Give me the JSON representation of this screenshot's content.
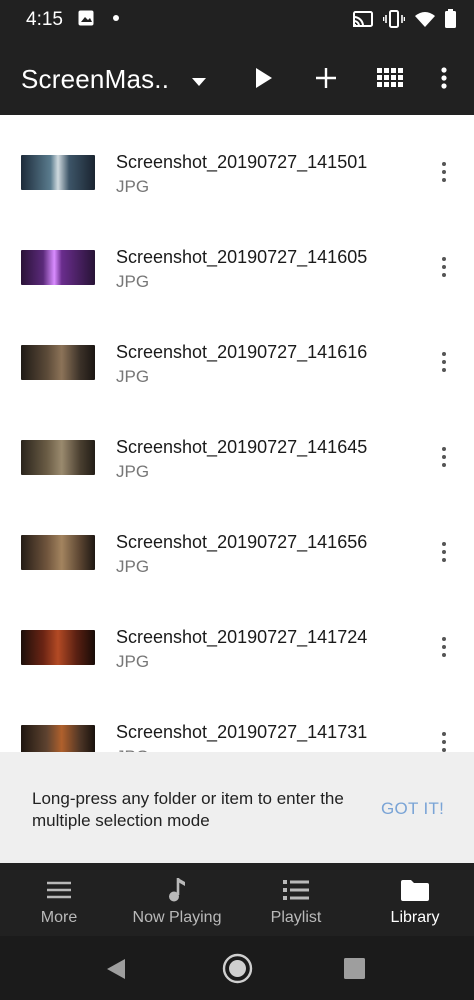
{
  "status_bar": {
    "time": "4:15"
  },
  "app_bar": {
    "title": "ScreenMas..",
    "actions": [
      "chevron-down-icon",
      "play-icon",
      "add-icon",
      "grid-icon",
      "more-vert-icon"
    ]
  },
  "files": [
    {
      "name": "Screenshot_20190727_141501",
      "type": "JPG"
    },
    {
      "name": "Screenshot_20190727_141605",
      "type": "JPG"
    },
    {
      "name": "Screenshot_20190727_141616",
      "type": "JPG"
    },
    {
      "name": "Screenshot_20190727_141645",
      "type": "JPG"
    },
    {
      "name": "Screenshot_20190727_141656",
      "type": "JPG"
    },
    {
      "name": "Screenshot_20190727_141724",
      "type": "JPG"
    },
    {
      "name": "Screenshot_20190727_141731",
      "type": "JPG"
    }
  ],
  "snackbar": {
    "message": "Long-press any folder or item to enter the multiple selection mode",
    "action": "GOT IT!"
  },
  "bottom_nav": [
    {
      "label": "More",
      "icon": "menu-icon",
      "active": false
    },
    {
      "label": "Now Playing",
      "icon": "music-note-icon",
      "active": false
    },
    {
      "label": "Playlist",
      "icon": "playlist-icon",
      "active": false
    },
    {
      "label": "Library",
      "icon": "folder-icon",
      "active": true
    }
  ],
  "colors": {
    "bar": "#212121",
    "snackbar_action": "#7aa4d6",
    "snackbar_bg": "#efefef"
  }
}
